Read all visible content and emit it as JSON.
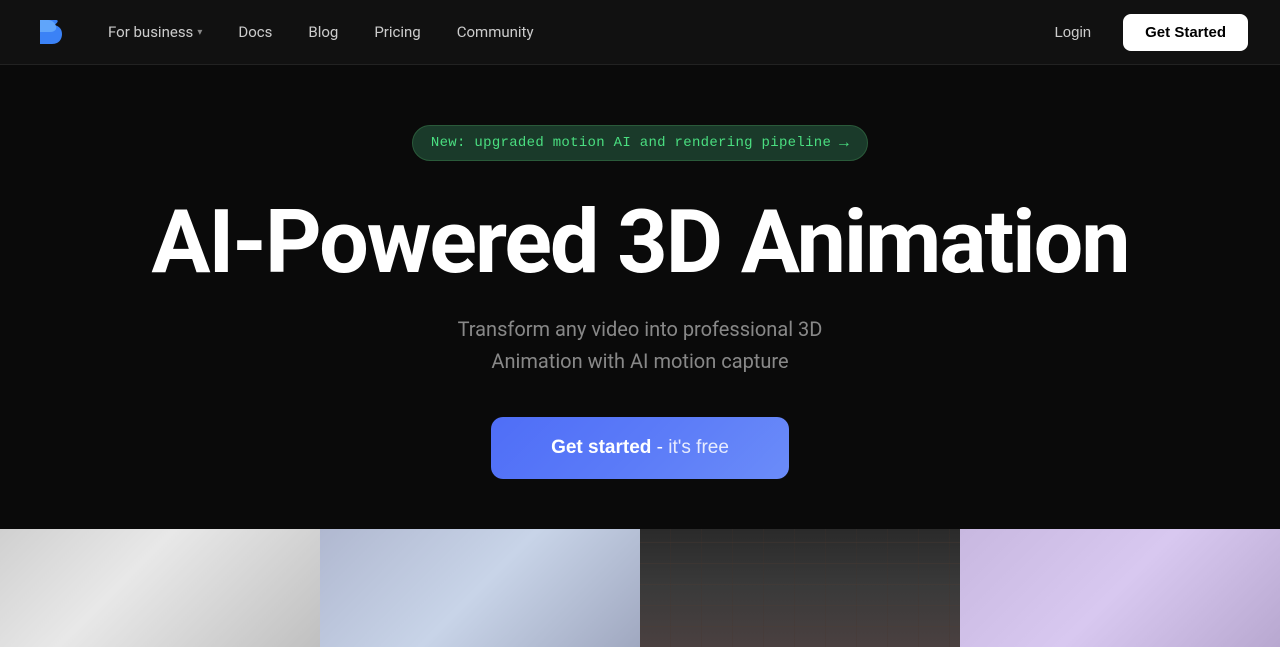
{
  "navbar": {
    "logo_alt": "Plask logo",
    "links": [
      {
        "label": "For business",
        "has_dropdown": true,
        "id": "for-business"
      },
      {
        "label": "Docs",
        "has_dropdown": false,
        "id": "docs"
      },
      {
        "label": "Blog",
        "has_dropdown": false,
        "id": "blog"
      },
      {
        "label": "Pricing",
        "has_dropdown": false,
        "id": "pricing"
      },
      {
        "label": "Community",
        "has_dropdown": false,
        "id": "community"
      }
    ],
    "login_label": "Login",
    "get_started_label": "Get Started"
  },
  "hero": {
    "announcement_text": "New: upgraded motion AI and rendering pipeline",
    "announcement_arrow": "→",
    "title": "AI-Powered 3D Animation",
    "subtitle_line1": "Transform any video into professional 3D",
    "subtitle_line2": "Animation with AI motion capture",
    "cta_bold": "Get started",
    "cta_separator": " - ",
    "cta_light": "it's free"
  },
  "gallery": {
    "items": [
      {
        "id": "gallery-1",
        "alt": "3D scene 1"
      },
      {
        "id": "gallery-2",
        "alt": "3D scene 2"
      },
      {
        "id": "gallery-3",
        "alt": "3D scene 3"
      },
      {
        "id": "gallery-4",
        "alt": "3D scene 4"
      }
    ]
  },
  "colors": {
    "navbar_bg": "#111111",
    "body_bg": "#0a0a0a",
    "badge_bg": "#1a3a2a",
    "badge_text": "#4ade80",
    "cta_bg": "#5b7bf8",
    "white": "#ffffff"
  }
}
